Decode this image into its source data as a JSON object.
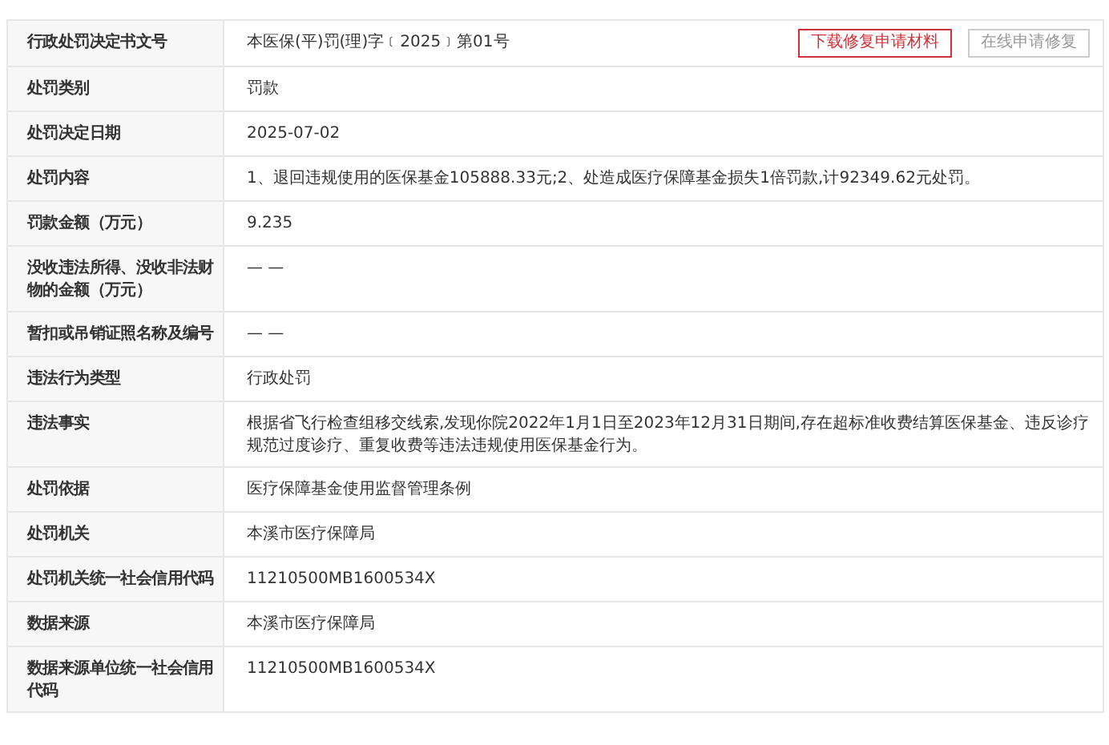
{
  "rows": [
    {
      "label": "行政处罚决定书文号",
      "value": "本医保(平)罚(理)字﹝2025﹞第01号",
      "buttons": [
        {
          "label": "下载修复申请材料",
          "disabled": false
        },
        {
          "label": "在线申请修复",
          "disabled": true
        }
      ]
    },
    {
      "label": "处罚类别",
      "value": "罚款"
    },
    {
      "label": "处罚决定日期",
      "value": "2025-07-02"
    },
    {
      "label": "处罚内容",
      "value": "1、退回违规使用的医保基金105888.33元;2、处造成医疗保障基金损失1倍罚款,计92349.62元处罚。"
    },
    {
      "label": "罚款金额（万元）",
      "value": "9.235"
    },
    {
      "label": "没收违法所得、没收非法财物的金额（万元）",
      "value": "— —"
    },
    {
      "label": "暂扣或吊销证照名称及编号",
      "value": "— —"
    },
    {
      "label": "违法行为类型",
      "value": "行政处罚"
    },
    {
      "label": "违法事实",
      "value": "根据省飞行检查组移交线索,发现你院2022年1月1日至2023年12月31日期间,存在超标准收费结算医保基金、违反诊疗规范过度诊疗、重复收费等违法违规使用医保基金行为。"
    },
    {
      "label": "处罚依据",
      "value": "医疗保障基金使用监督管理条例"
    },
    {
      "label": "处罚机关",
      "value": "本溪市医疗保障局"
    },
    {
      "label": "处罚机关统一社会信用代码",
      "value": "11210500MB1600534X"
    },
    {
      "label": "数据来源",
      "value": "本溪市医疗保障局"
    },
    {
      "label": "数据来源单位统一社会信用代码",
      "value": "11210500MB1600534X"
    }
  ]
}
